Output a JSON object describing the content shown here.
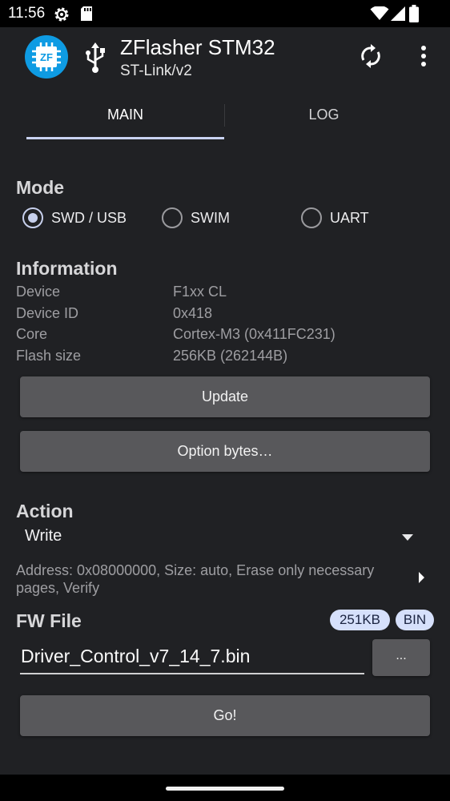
{
  "status_bar": {
    "time": "11:56"
  },
  "app_bar": {
    "title": "ZFlasher STM32",
    "subtitle": "ST-Link/v2",
    "logo_text": "ZF"
  },
  "tabs": [
    {
      "label": "MAIN",
      "selected": true
    },
    {
      "label": "LOG",
      "selected": false
    }
  ],
  "mode": {
    "heading": "Mode",
    "options": [
      {
        "label": "SWD / USB",
        "selected": true
      },
      {
        "label": "SWIM",
        "selected": false
      },
      {
        "label": "UART",
        "selected": false
      }
    ]
  },
  "information": {
    "heading": "Information",
    "rows": [
      {
        "key": "Device",
        "value": "F1xx CL"
      },
      {
        "key": "Device ID",
        "value": "0x418"
      },
      {
        "key": "Core",
        "value": "Cortex-M3 (0x411FC231)"
      },
      {
        "key": "Flash size",
        "value": "256KB (262144B)"
      }
    ],
    "update_button": "Update",
    "option_bytes_button": "Option bytes…"
  },
  "action": {
    "heading": "Action",
    "selected": "Write",
    "description": "Address: 0x08000000, Size: auto, Erase only necessary pages, Verify"
  },
  "fw_file": {
    "heading": "FW File",
    "size_badge": "251KB",
    "type_badge": "BIN",
    "file_name": "Driver_Control_v7_14_7.bin",
    "browse_button": "...",
    "go_button": "Go!"
  },
  "colors": {
    "background": "#202124",
    "accent": "#c9d3f2",
    "button": "#58585b",
    "logo": "#0e9be3",
    "badge": "#d6e0fb"
  }
}
